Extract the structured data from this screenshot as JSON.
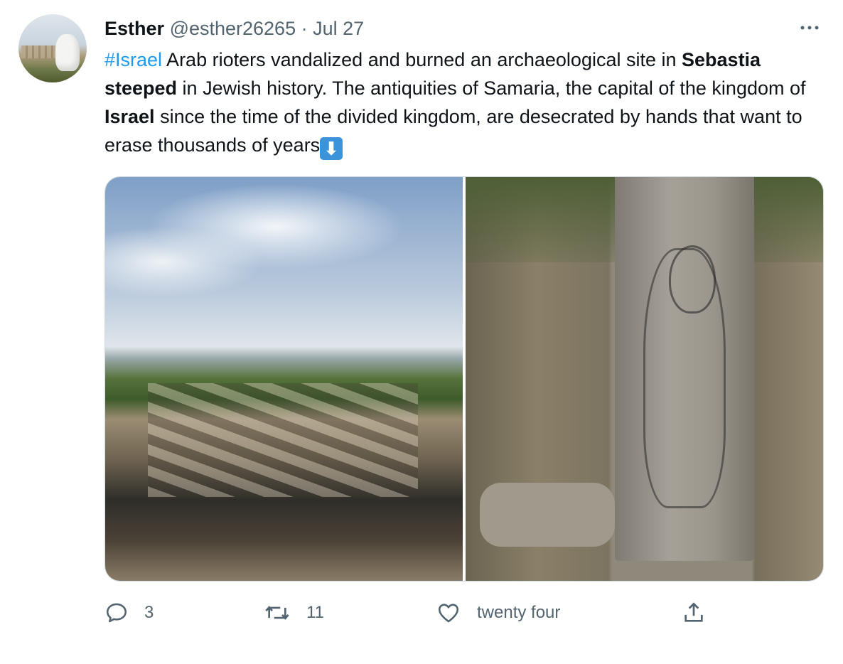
{
  "author": {
    "name": "Esther",
    "handle": "@esther26265",
    "separator": "·",
    "date": "Jul 27"
  },
  "more_icon": "more-horizontal-icon",
  "tweet": {
    "segments": [
      {
        "text": "#Israel",
        "style": "hashtag"
      },
      {
        "text": " Arab rioters vandalized and burned an archaeological site in ",
        "style": "normal"
      },
      {
        "text": "Sebastia steeped",
        "style": "bold"
      },
      {
        "text": " in Jewish history. The antiquities of Samaria, the capital of the kingdom of ",
        "style": "normal"
      },
      {
        "text": "Israel",
        "style": "bold"
      },
      {
        "text": " since the time of the divided kingdom, are desecrated by hands that want to erase thousands of years",
        "style": "normal"
      }
    ],
    "emoji": "⬇"
  },
  "media": {
    "images": [
      {
        "name": "burned-archaeological-site-photo"
      },
      {
        "name": "vandalized-column-photo"
      }
    ]
  },
  "actions": {
    "reply": {
      "icon": "reply-icon",
      "count": "3"
    },
    "retweet": {
      "icon": "retweet-icon",
      "count": "11"
    },
    "like": {
      "icon": "heart-icon",
      "count": "twenty four"
    },
    "share": {
      "icon": "share-icon"
    }
  },
  "colors": {
    "link": "#1d9bf0",
    "secondary_text": "#536471",
    "primary_text": "#0f1419",
    "border": "#cfd9de"
  }
}
